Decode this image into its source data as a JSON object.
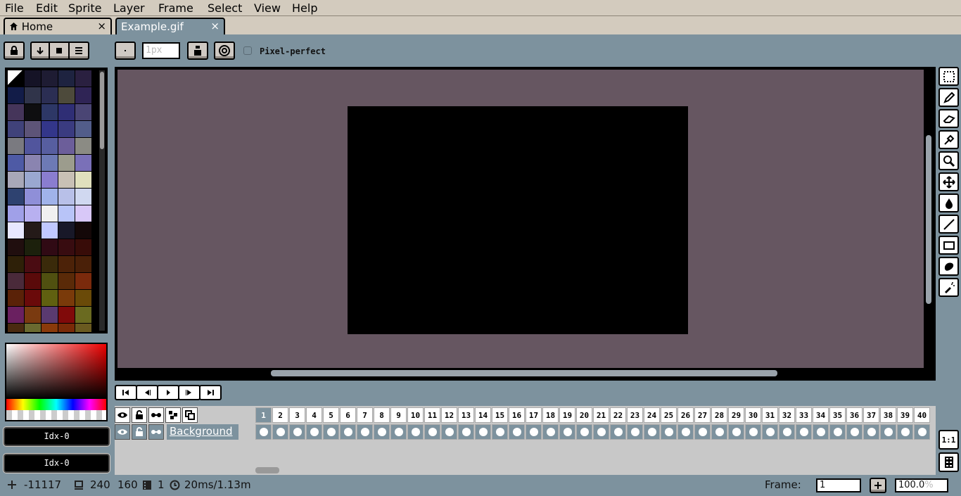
{
  "menu": {
    "items": [
      {
        "label": "File"
      },
      {
        "label": "Edit"
      },
      {
        "label": "Sprite"
      },
      {
        "label": "Layer"
      },
      {
        "label": "Frame"
      },
      {
        "label": "Select"
      },
      {
        "label": "View"
      },
      {
        "label": "Help"
      }
    ]
  },
  "tabs": {
    "home": "Home",
    "active": "Example.gif",
    "close_glyph": "×"
  },
  "toolbar": {
    "brush_size_placeholder": "1px",
    "pixel_perfect_label": "Pixel-perfect"
  },
  "palette": {
    "colors": [
      "#000000",
      "#151326",
      "#1e1c33",
      "#1e2340",
      "#2a2040",
      "#121c48",
      "#30344a",
      "#2b2e53",
      "#4d4a3b",
      "#2f2455",
      "#45355a",
      "#0e0e10",
      "#2d3766",
      "#2f2e75",
      "#4a4574",
      "#40427a",
      "#5d5478",
      "#33368a",
      "#3a3b80",
      "#525d8a",
      "#7a7a80",
      "#51559d",
      "#575ea0",
      "#6c5e9a",
      "#8b8b84",
      "#4e5aa5",
      "#8a84b0",
      "#6d7ab5",
      "#9c9c8d",
      "#7a70b8",
      "#a8a8b8",
      "#9aa8d0",
      "#8a7dd0",
      "#c8c0b5",
      "#e0e0bd",
      "#2e4270",
      "#8f8fd8",
      "#a0b3ea",
      "#b8c0e8",
      "#d0d8f0",
      "#a0a0e8",
      "#b8b0f0",
      "#f0f0f0",
      "#b8c4f8",
      "#d8c8f8",
      "#e8e8ff",
      "#241a18",
      "#c0c8ff",
      "#181828",
      "#140808",
      "#200e0e",
      "#1c200c",
      "#300a14",
      "#380c10",
      "#380c08",
      "#2e2008",
      "#4a0c12",
      "#3a2a0a",
      "#4c2208",
      "#4a2008",
      "#4a2a3a",
      "#5a0a0a",
      "#505010",
      "#5a2a08",
      "#7a2a0c",
      "#5a2208",
      "#6a0a0a",
      "#606010",
      "#7a3a0a",
      "#6a4a08",
      "#6a2060",
      "#7a3a10",
      "#5a3a70",
      "#800a0a",
      "#6a6a20",
      "#4a2a10",
      "#6a6a30",
      "#8a3a0a",
      "#7a2a08",
      "#6a5a20"
    ]
  },
  "color_indices": {
    "foreground": "Idx-0",
    "background": "Idx-0"
  },
  "timeline": {
    "layer_name": "Background",
    "frames": [
      "1",
      "2",
      "3",
      "4",
      "5",
      "6",
      "7",
      "8",
      "9",
      "10",
      "11",
      "12",
      "13",
      "14",
      "15",
      "16",
      "17",
      "18",
      "19",
      "20",
      "21",
      "22",
      "23",
      "24",
      "25",
      "26",
      "27",
      "28",
      "29",
      "30",
      "31",
      "32",
      "33",
      "34",
      "35",
      "36",
      "37",
      "38",
      "39",
      "40"
    ],
    "active_frame": "1"
  },
  "status": {
    "cursor_x": "-111",
    "cursor_y": "17",
    "sprite_w": "240",
    "sprite_h": "160",
    "frame_count": "1",
    "timing": "20ms/1.13m",
    "frame_label": "Frame:",
    "frame_value": "1",
    "zoom_value": "100.0",
    "zoom_unit": "%",
    "ratio_label": "1:1"
  },
  "colors": {
    "chrome": "#d3cbbe",
    "background": "#7d929e",
    "canvas_bg": "#665661",
    "sprite": "#000000"
  }
}
